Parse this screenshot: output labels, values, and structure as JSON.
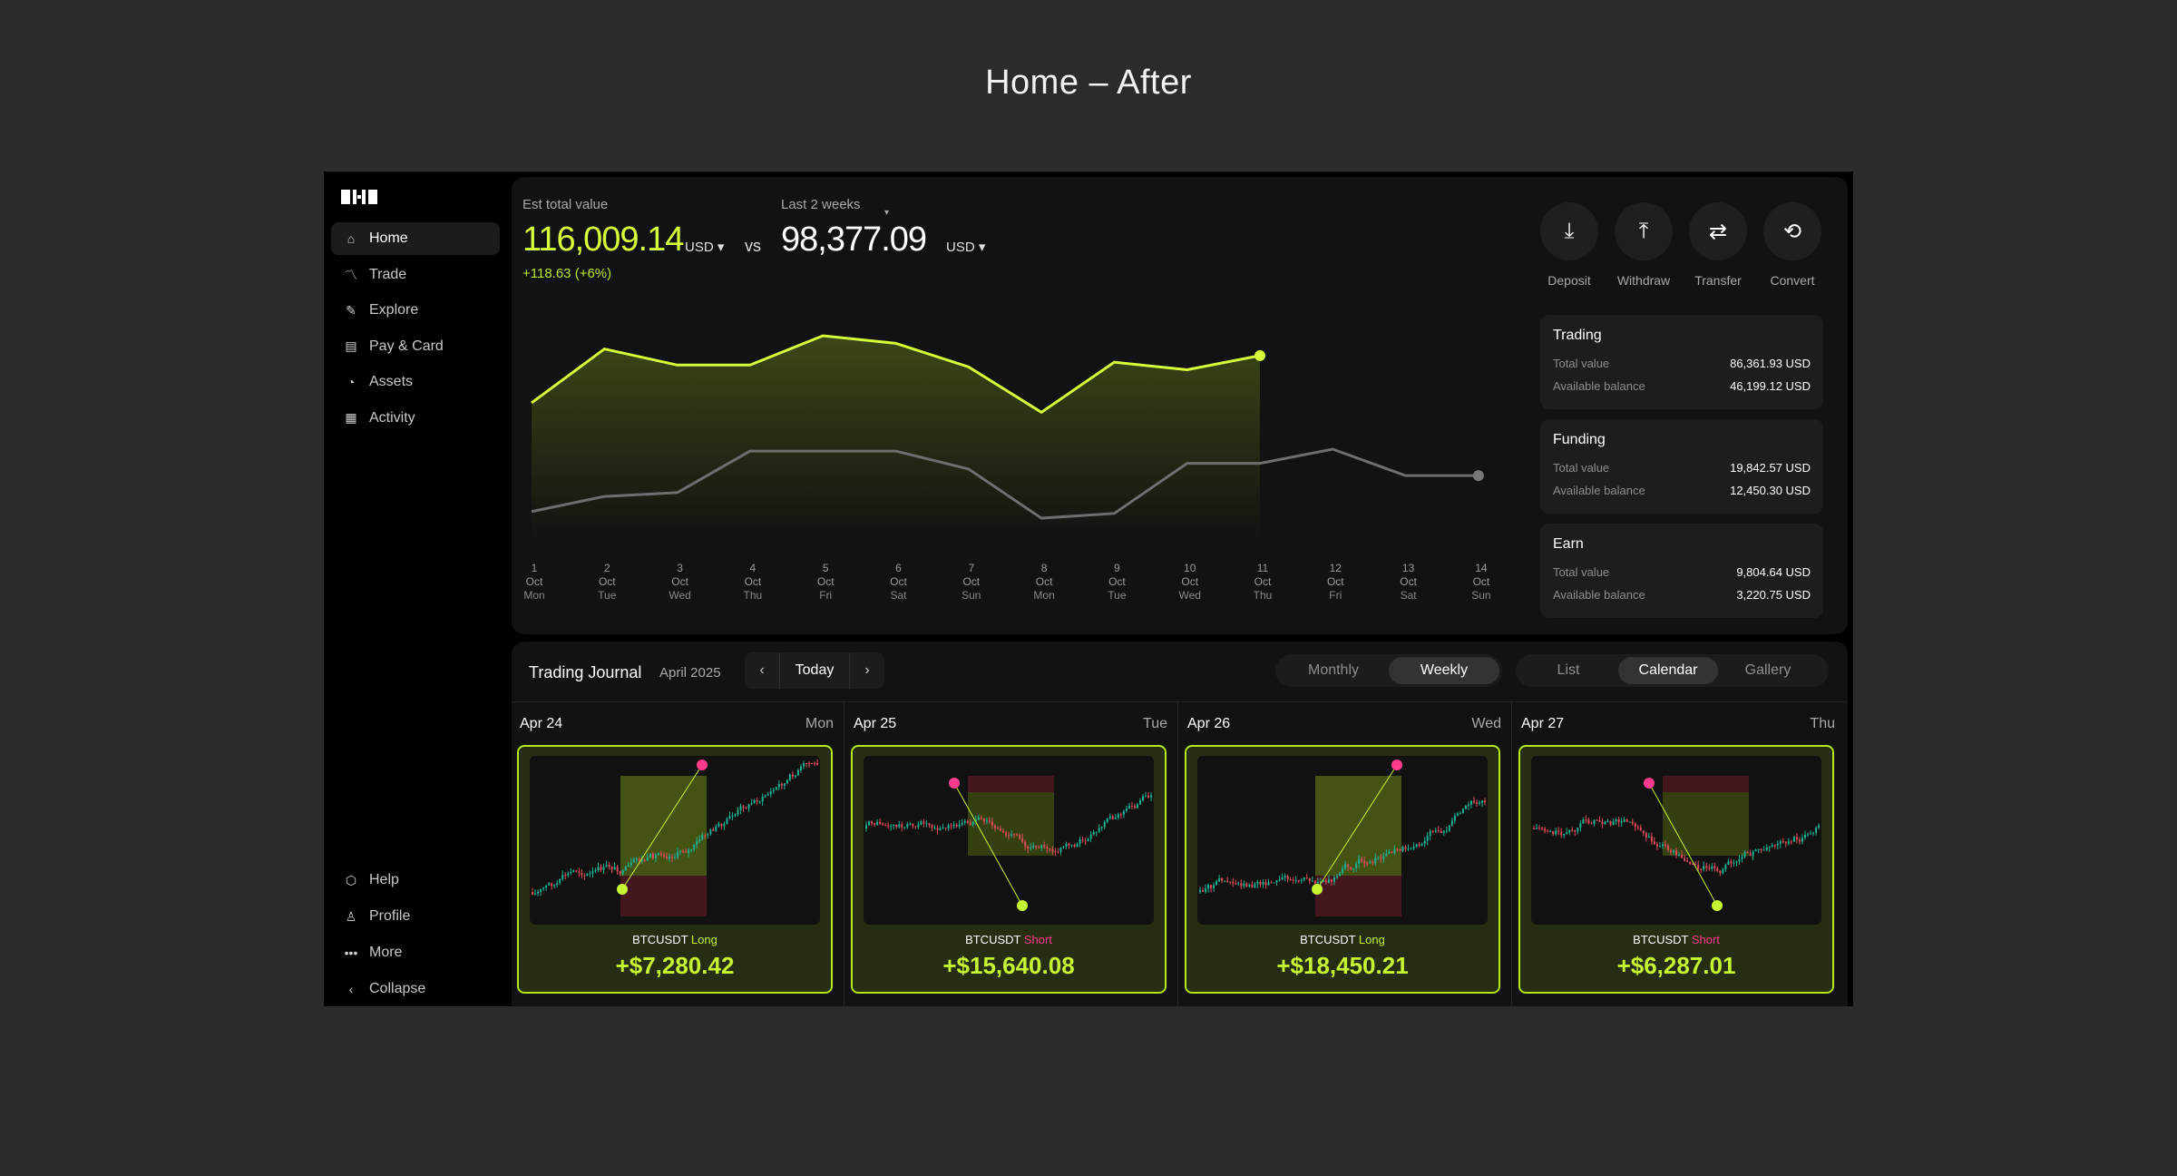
{
  "page": {
    "title": "Home – After"
  },
  "sidebar": {
    "items": [
      {
        "label": "Home",
        "icon": "home-icon"
      },
      {
        "label": "Trade",
        "icon": "trade-icon"
      },
      {
        "label": "Explore",
        "icon": "explore-icon"
      },
      {
        "label": "Pay & Card",
        "icon": "card-icon"
      },
      {
        "label": "Assets",
        "icon": "pie-icon"
      },
      {
        "label": "Activity",
        "icon": "activity-icon"
      }
    ],
    "bottom": [
      {
        "label": "Help",
        "icon": "help-icon"
      },
      {
        "label": "Profile",
        "icon": "profile-icon"
      },
      {
        "label": "More",
        "icon": "more-icon"
      },
      {
        "label": "Collapse",
        "icon": "chevron-left-icon"
      }
    ]
  },
  "summary": {
    "est_label": "Est total value",
    "est_value": "116,009.14",
    "est_currency": "USD",
    "change": "+118.63 (+6%)",
    "vs": "vs",
    "period_label": "Last 2 weeks",
    "period_value": "98,377.09",
    "period_currency": "USD"
  },
  "actions": [
    {
      "label": "Deposit",
      "icon": "deposit-icon",
      "glyph": "⤓"
    },
    {
      "label": "Withdraw",
      "icon": "withdraw-icon",
      "glyph": "⤒"
    },
    {
      "label": "Transfer",
      "icon": "transfer-icon",
      "glyph": "⇄"
    },
    {
      "label": "Convert",
      "icon": "convert-icon",
      "glyph": "⟲"
    }
  ],
  "accounts": [
    {
      "title": "Trading",
      "total_label": "Total value",
      "total": "86,361.93 USD",
      "avail_label": "Available balance",
      "avail": "46,199.12 USD"
    },
    {
      "title": "Funding",
      "total_label": "Total value",
      "total": "19,842.57 USD",
      "avail_label": "Available balance",
      "avail": "12,450.30 USD"
    },
    {
      "title": "Earn",
      "total_label": "Total value",
      "total": "9,804.64 USD",
      "avail_label": "Available balance",
      "avail": "3,220.75 USD"
    }
  ],
  "chart_data": {
    "type": "area",
    "x": [
      [
        "1",
        "Oct",
        "Mon"
      ],
      [
        "2",
        "Oct",
        "Tue"
      ],
      [
        "3",
        "Oct",
        "Wed"
      ],
      [
        "4",
        "Oct",
        "Thu"
      ],
      [
        "5",
        "Oct",
        "Fri"
      ],
      [
        "6",
        "Oct",
        "Sat"
      ],
      [
        "7",
        "Oct",
        "Sun"
      ],
      [
        "8",
        "Oct",
        "Mon"
      ],
      [
        "9",
        "Oct",
        "Tue"
      ],
      [
        "10",
        "Oct",
        "Wed"
      ],
      [
        "11",
        "Oct",
        "Thu"
      ],
      [
        "12",
        "Oct",
        "Fri"
      ],
      [
        "13",
        "Oct",
        "Sat"
      ],
      [
        "14",
        "Oct",
        "Sun"
      ]
    ],
    "series": [
      {
        "values": [
          108500,
          114200,
          112500,
          112500,
          115600,
          114800,
          112300,
          107500,
          112800,
          112000,
          113500
        ],
        "color": "#d4ff3a"
      },
      {
        "values": [
          97000,
          98600,
          99000,
          103400,
          103400,
          103400,
          101500,
          96300,
          96800,
          102100,
          102100,
          103600,
          100800,
          100800
        ],
        "color": "#6e6e6e"
      }
    ],
    "ylim": [
      94000,
      118000
    ]
  },
  "journal": {
    "title": "Trading Journal",
    "month": "April 2025",
    "today": "Today",
    "views": [
      "Monthly",
      "Weekly"
    ],
    "active_view": "Weekly",
    "modes": [
      "List",
      "Calendar",
      "Gallery"
    ],
    "active_mode": "Calendar",
    "days": [
      {
        "date": "Apr 24",
        "day": "Mon",
        "symbol": "BTCUSDT",
        "side": "Long",
        "pnl": "+$7,280.42"
      },
      {
        "date": "Apr 25",
        "day": "Tue",
        "symbol": "BTCUSDT",
        "side": "Short",
        "pnl": "+$15,640.08"
      },
      {
        "date": "Apr 26",
        "day": "Wed",
        "symbol": "BTCUSDT",
        "side": "Long",
        "pnl": "+$18,450.21"
      },
      {
        "date": "Apr 27",
        "day": "Thu",
        "symbol": "BTCUSDT",
        "side": "Short",
        "pnl": "+$6,287.01"
      }
    ]
  }
}
